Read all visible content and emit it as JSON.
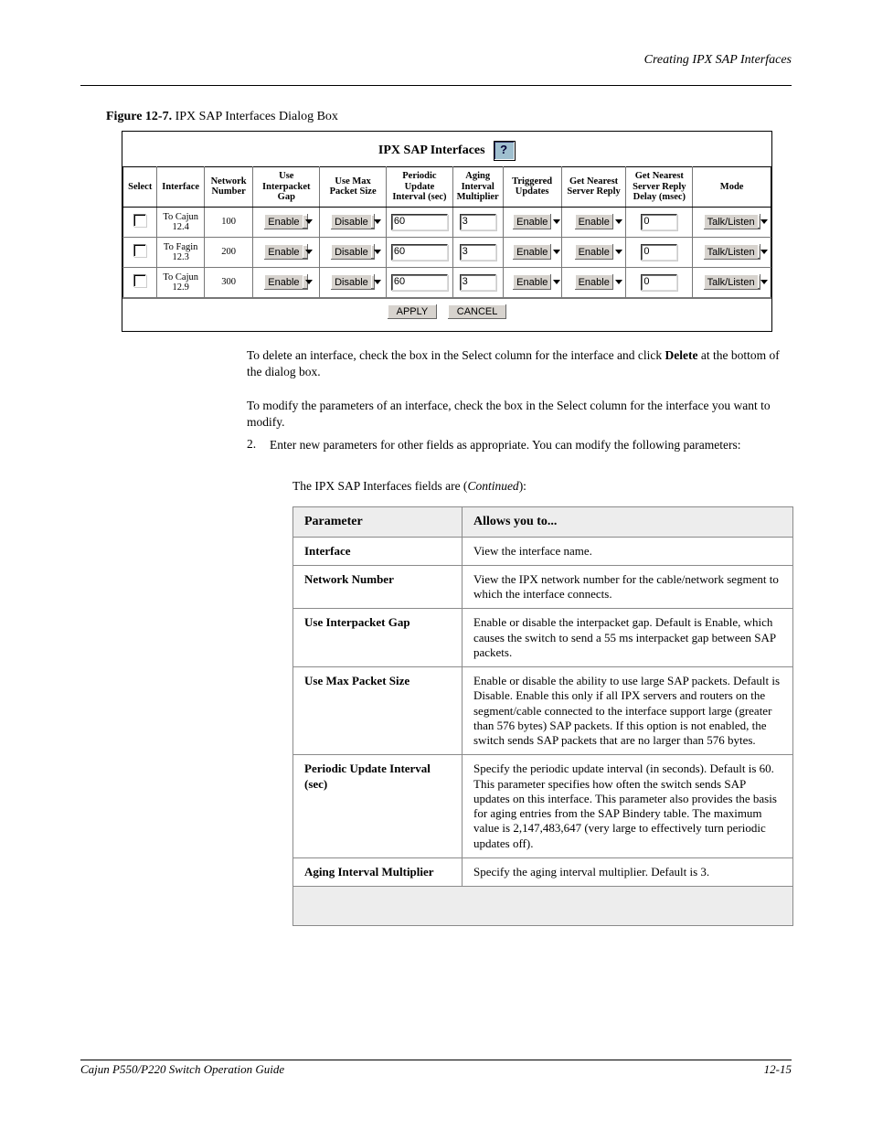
{
  "header": {
    "caption": "Creating IPX SAP Interfaces"
  },
  "figure": {
    "label": "Figure 12-7.",
    "title": "IPX SAP Interfaces Dialog Box",
    "screenshot_title": "IPX SAP Interfaces",
    "help_icon": "help-question-icon",
    "columns": [
      "Select",
      "Interface",
      "Network Number",
      "Use Interpacket Gap",
      "Use Max Packet Size",
      "Periodic Update Interval (sec)",
      "Aging Interval Multiplier",
      "Triggered Updates",
      "Get Nearest Server Reply",
      "Get Nearest Server Reply Delay (msec)",
      "Mode"
    ],
    "rows": [
      {
        "interface": "To Cajun 12.4",
        "network": "100",
        "useInterpacketGap": "Enable",
        "useMaxPacket": "Disable",
        "periodicUpdate": "60",
        "agingMultiplier": "3",
        "triggeredUpdates": "Enable",
        "getNearestReply": "Enable",
        "getNearestDelay": "0",
        "mode": "Talk/Listen"
      },
      {
        "interface": "To Fagin 12.3",
        "network": "200",
        "useInterpacketGap": "Enable",
        "useMaxPacket": "Disable",
        "periodicUpdate": "60",
        "agingMultiplier": "3",
        "triggeredUpdates": "Enable",
        "getNearestReply": "Enable",
        "getNearestDelay": "0",
        "mode": "Talk/Listen"
      },
      {
        "interface": "To Cajun 12.9",
        "network": "300",
        "useInterpacketGap": "Enable",
        "useMaxPacket": "Disable",
        "periodicUpdate": "60",
        "agingMultiplier": "3",
        "triggeredUpdates": "Enable",
        "getNearestReply": "Enable",
        "getNearestDelay": "0",
        "mode": "Talk/Listen"
      }
    ],
    "buttons": {
      "apply": "APPLY",
      "cancel": "CANCEL"
    }
  },
  "text": {
    "instruction1": "To delete an interface, check the box in the Select column for the interface and click ",
    "instruction1_bold": "Delete",
    "instruction1_tail": " at the bottom of the dialog box.",
    "instruction2": "To modify the parameters of an interface, check the box in the Select column for the interface you want to modify.",
    "step_num": "2.",
    "step_text": "Enter new parameters for other fields as appropriate. You can modify the following parameters:",
    "fieldnote_plain": "The IPX SAP Interfaces fields are (",
    "fieldnote_italic": "Continued",
    "fieldnote_tail": "):"
  },
  "param_table": {
    "headers": [
      "Parameter",
      "Allows you to..."
    ],
    "rows": [
      {
        "param": "Interface",
        "desc": "View the interface name."
      },
      {
        "param": "Network Number",
        "desc": "View the IPX network number for the cable/network segment to which the interface connects."
      },
      {
        "param": "Use Interpacket Gap",
        "desc": "Enable or disable the interpacket gap. Default is Enable, which causes the switch to send a 55 ms interpacket gap between SAP packets."
      },
      {
        "param": "Use Max Packet Size",
        "desc": "Enable or disable the ability to use large SAP packets. Default is Disable. Enable this only if all IPX servers and routers on the segment/cable connected to the interface support large (greater than 576 bytes) SAP packets. If this option is not enabled, the switch sends SAP packets that are no larger than 576 bytes."
      },
      {
        "param": "Periodic Update Interval (sec)",
        "desc": "Specify the periodic update interval (in seconds). Default is 60. This parameter specifies how often the switch sends SAP updates on this interface. This parameter also provides the basis for aging entries from the SAP Bindery table. The maximum value is 2,147,483,647 (very large to effectively turn periodic updates off)."
      },
      {
        "param": "Aging Interval Multiplier",
        "desc": "Specify the aging interval multiplier. Default is 3."
      },
      {
        "param": "",
        "desc": "",
        "footer": true
      }
    ]
  },
  "footer": {
    "left": "Cajun P550/P220 Switch Operation Guide",
    "right": "12-15"
  }
}
